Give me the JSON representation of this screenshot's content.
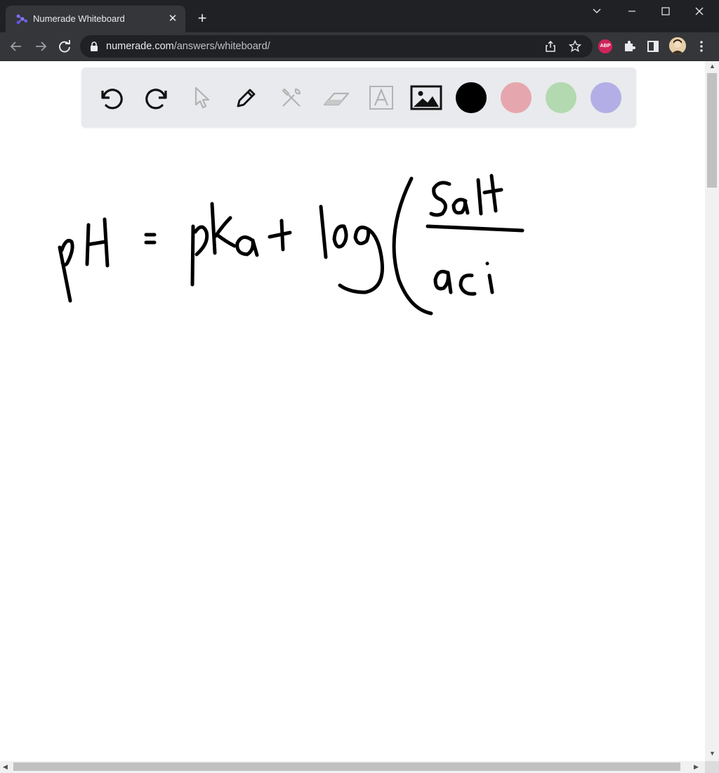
{
  "browser": {
    "tab": {
      "title": "Numerade Whiteboard",
      "close_symbol": "✕"
    },
    "new_tab_symbol": "+",
    "url": {
      "host": "numerade.com",
      "path": "/answers/whiteboard/"
    },
    "extensions": {
      "abp_label": "ABP"
    }
  },
  "whiteboard": {
    "tools": [
      "undo-icon",
      "redo-icon",
      "pointer-icon",
      "pen-icon",
      "tools-icon",
      "eraser-icon",
      "text-icon",
      "image-icon"
    ],
    "colors": {
      "black": "#000000",
      "red": "#e6a6ad",
      "green": "#b3d9b0",
      "purple": "#b4aee6"
    },
    "handwriting": "pH = pKa + log( Salt / aci"
  }
}
